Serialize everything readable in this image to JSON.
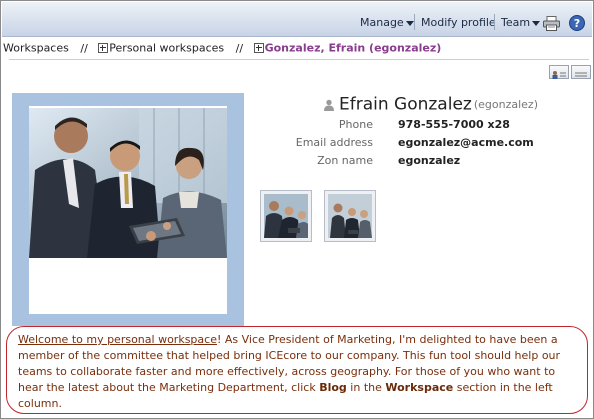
{
  "toolbar": {
    "manage_label": "Manage",
    "modify_profile_label": "Modify profile",
    "team_label": "Team",
    "help_label": "?"
  },
  "breadcrumb": {
    "items": [
      "Workspaces",
      "Personal workspaces",
      "Gonzalez, Efrain (egonzalez)"
    ],
    "separator": "//"
  },
  "profile": {
    "name": "Efrain Gonzalez",
    "username": "(egonzalez)",
    "fields": [
      {
        "label": "Phone",
        "value": "978-555-7000 x28"
      },
      {
        "label": "Email address",
        "value": "egonzalez@acme.com"
      },
      {
        "label": "Zon name",
        "value": "egonzalez"
      }
    ]
  },
  "welcome": {
    "link_text": "Welcome to my personal workspace",
    "text_part1": "! As Vice President of Marketing, I'm delighted to have been a member of the committee that helped bring ICEcore to our company. This fun tool should help our teams to collaborate faster and more effectively, across geography. For those of you who want to hear the latest about the Marketing Department, click ",
    "blog_label": "Blog",
    "text_part2": " in the ",
    "workspace_label": "Workspace",
    "text_part3": " section in the left column."
  },
  "colors": {
    "toolbar_top": "#eef2f8",
    "toolbar_bottom": "#c7d3e6",
    "breadcrumb_current": "#8a3d8f",
    "photo_frame": "#a9c2e0",
    "welcome_text": "#7a2e0b",
    "welcome_outline": "#c0262b"
  },
  "icons": [
    "chevron-down-icon",
    "print-icon",
    "help-icon",
    "expand-icon",
    "person-icon",
    "view-icon"
  ]
}
